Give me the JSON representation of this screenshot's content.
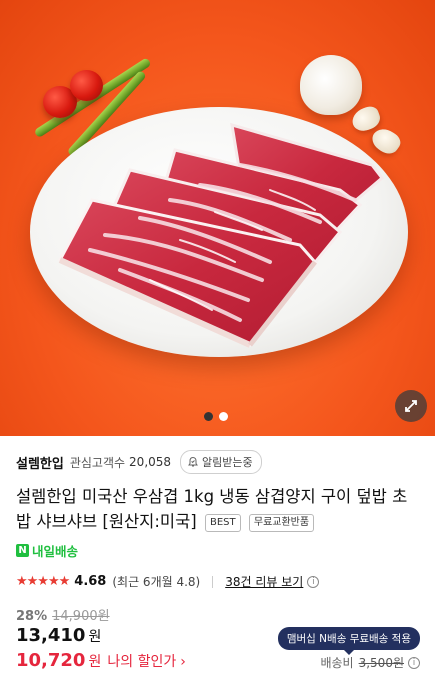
{
  "image": {
    "dots": [
      {
        "active": true
      },
      {
        "active": false
      }
    ],
    "expand_icon": "expand-arrows-icon"
  },
  "store": {
    "name": "설렘한입",
    "fan_label": "관심고객수",
    "fan_count": "20,058",
    "notify_label": "알림받는중",
    "notify_icon": "bell-check-icon"
  },
  "product": {
    "title": "설렘한입 미국산 우삼겹 1kg 냉동 삼겹양지 구이 덮밥 초밥 샤브샤브 [원산지:미국]",
    "badges": [
      "BEST",
      "무료교환반품"
    ]
  },
  "delivery": {
    "icon": "n-logo-icon",
    "label": "내일배송",
    "color": "#1fbf3f"
  },
  "rating": {
    "stars": "★★★★★",
    "score": "4.68",
    "recent": "(최근 6개월 4.8)",
    "reviews": "38건 리뷰 보기"
  },
  "price": {
    "discount_rate": "28%",
    "original": "14,900원",
    "current": "13,410",
    "currency": "원",
    "my_price": "10,720",
    "my_label": "나의 할인가",
    "my_chevron": "›",
    "accent": "#e5263d"
  },
  "shipping": {
    "member_badge": "맴버십 N배송 무료배송 적용",
    "label": "배송비",
    "value": "3,500원"
  }
}
